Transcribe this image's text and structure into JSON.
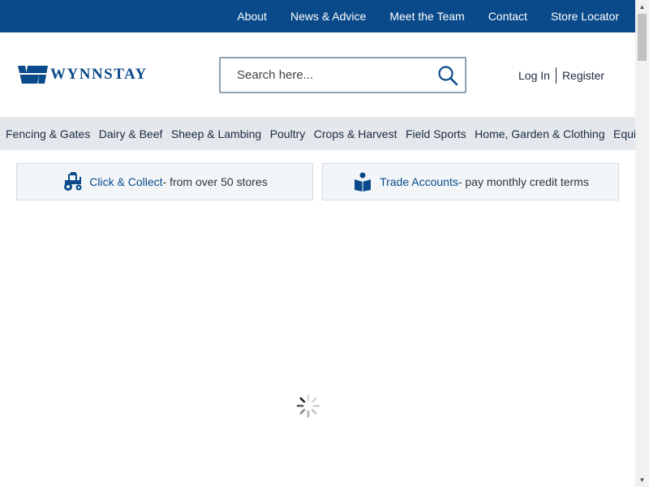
{
  "topnav": {
    "items": [
      "About",
      "News & Advice",
      "Meet the Team",
      "Contact",
      "Store Locator"
    ]
  },
  "brand": {
    "name": "WYNNSTAY",
    "color": "#0a4a8a"
  },
  "search": {
    "placeholder": "Search here...",
    "value": "",
    "icon": "search-icon"
  },
  "auth": {
    "login": "Log In",
    "register": "Register"
  },
  "categories": [
    "Fencing & Gates",
    "Dairy & Beef",
    "Sheep & Lambing",
    "Poultry",
    "Crops & Harvest",
    "Field Sports",
    "Home, Garden & Clothing",
    "Equine"
  ],
  "promos": {
    "click_collect": {
      "link": "Click & Collect",
      "text": "- from over 50 stores",
      "icon": "tractor-icon"
    },
    "trade": {
      "link": "Trade Accounts",
      "text": "- pay monthly credit terms",
      "icon": "account-book-icon"
    }
  },
  "status": {
    "loading_icon": "loading-spinner-icon"
  },
  "colors": {
    "topbar": "#0a4a8a",
    "nav_bg": "#e4e8ec",
    "promo_bg": "#f2f6f9",
    "link": "#0a4a8a"
  }
}
